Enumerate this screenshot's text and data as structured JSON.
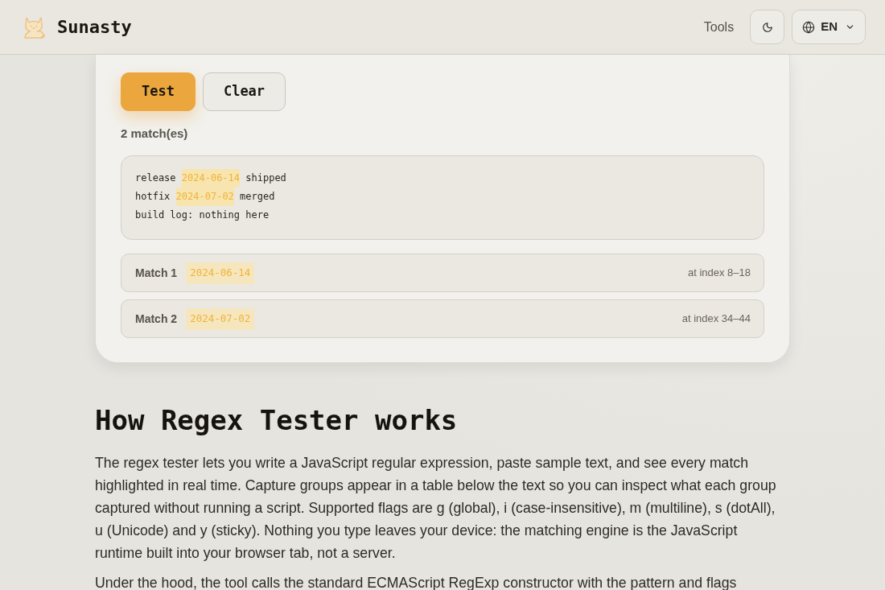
{
  "header": {
    "brand": "Sunasty",
    "nav": [
      {
        "label": "Tools"
      }
    ],
    "language": {
      "label": "EN"
    }
  },
  "actions": [
    {
      "label": "Test",
      "kind": "primary"
    },
    {
      "label": "Clear",
      "kind": "secondary"
    }
  ],
  "match_count": "2 match(es)",
  "sample_text": {
    "lines": [
      [
        {
          "text": "release ",
          "highlighted": false
        },
        {
          "text": "2024-06-14",
          "highlighted": true
        },
        {
          "text": " shipped",
          "highlighted": false
        }
      ],
      [
        {
          "text": "hotfix ",
          "highlighted": false
        },
        {
          "text": "2024-07-02",
          "highlighted": true
        },
        {
          "text": " merged",
          "highlighted": false
        }
      ],
      [
        {
          "text": "build log: nothing here",
          "highlighted": false
        }
      ]
    ]
  },
  "matches": [
    {
      "label": "Match 1",
      "value": "2024-06-14",
      "position": "at index 8–18"
    },
    {
      "label": "Match 2",
      "value": "2024-07-02",
      "position": "at index 34–44"
    }
  ],
  "article": {
    "heading": "How Regex Tester works",
    "paragraphs": [
      "The regex tester lets you write a JavaScript regular expression, paste sample text, and see every match highlighted in real time. Capture groups appear in a table below the text so you can inspect what each group captured without running a script. Supported flags are g (global), i (case-insensitive), m (multiline), s (dotAll), u (Unicode) and y (sticky). Nothing you type leaves your device: the matching engine is the JavaScript runtime built into your browser tab, not a server.",
      "Under the hood, the tool calls the standard ECMAScript RegExp constructor with the pattern and flags"
    ]
  }
}
